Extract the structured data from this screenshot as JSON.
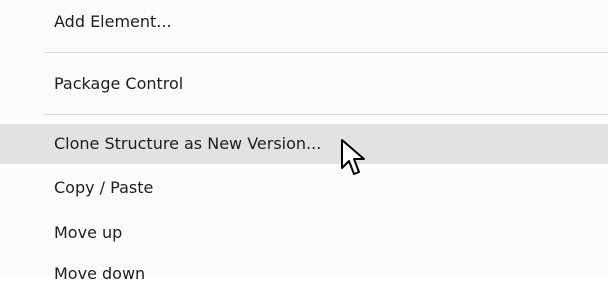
{
  "menu": {
    "items": [
      {
        "label": "Add Element..."
      },
      {
        "label": "Package Control"
      },
      {
        "label": "Clone Structure as New Version...",
        "highlighted": true
      },
      {
        "label": "Copy / Paste"
      },
      {
        "label": "Move up"
      },
      {
        "label": "Move down"
      }
    ]
  },
  "colors": {
    "menu_background": "#fbfbfb",
    "highlight": "#e2e2e2",
    "separator": "#d8d8d8",
    "text": "#1e1e1e"
  },
  "icons": {
    "cursor": "mouse-pointer-icon"
  }
}
